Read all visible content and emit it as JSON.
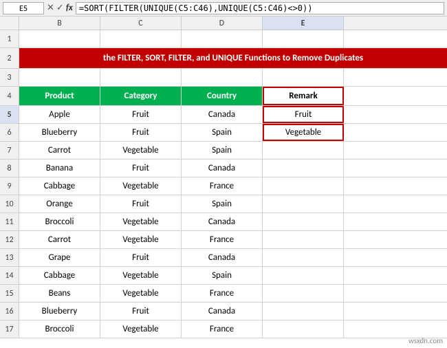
{
  "cellRef": "E5",
  "formula": "=SORT(FILTER(UNIQUE(C5:C46),UNIQUE(C5:C46)<>0))",
  "colHeaders": [
    "",
    "A",
    "B",
    "C",
    "D",
    "E"
  ],
  "banner": "the FILTER, SORT, FILTER, and UNIQUE Functions to Remove Duplicates",
  "headers": {
    "product": "Product",
    "category": "Category",
    "country": "Country",
    "remark": "Remark"
  },
  "rows": [
    {
      "num": 5,
      "product": "Apple",
      "category": "Fruit",
      "country": "Canada",
      "remark": "Fruit",
      "remarkSelected": true
    },
    {
      "num": 6,
      "product": "Blueberry",
      "category": "Fruit",
      "country": "Spain",
      "remark": "Vegetable",
      "remarkSelected": true
    },
    {
      "num": 7,
      "product": "Carrot",
      "category": "Vegetable",
      "country": "Spain",
      "remark": ""
    },
    {
      "num": 8,
      "product": "Banana",
      "category": "Fruit",
      "country": "Canada",
      "remark": ""
    },
    {
      "num": 9,
      "product": "Cabbage",
      "category": "Vegetable",
      "country": "France",
      "remark": ""
    },
    {
      "num": 10,
      "product": "Orange",
      "category": "Fruit",
      "country": "Spain",
      "remark": ""
    },
    {
      "num": 11,
      "product": "Broccoli",
      "category": "Vegetable",
      "country": "Canada",
      "remark": ""
    },
    {
      "num": 12,
      "product": "Carrot",
      "category": "Vegetable",
      "country": "France",
      "remark": ""
    },
    {
      "num": 13,
      "product": "Grape",
      "category": "Fruit",
      "country": "Canada",
      "remark": ""
    },
    {
      "num": 14,
      "product": "Cabbage",
      "category": "Vegetable",
      "country": "Spain",
      "remark": ""
    },
    {
      "num": 15,
      "product": "Beans",
      "category": "Vegetable",
      "country": "France",
      "remark": ""
    },
    {
      "num": 16,
      "product": "Blueberry",
      "category": "Fruit",
      "country": "Canada",
      "remark": ""
    },
    {
      "num": 17,
      "product": "Broccoli",
      "category": "Vegetable",
      "country": "France",
      "remark": ""
    }
  ],
  "watermark": "wsxdn.com"
}
